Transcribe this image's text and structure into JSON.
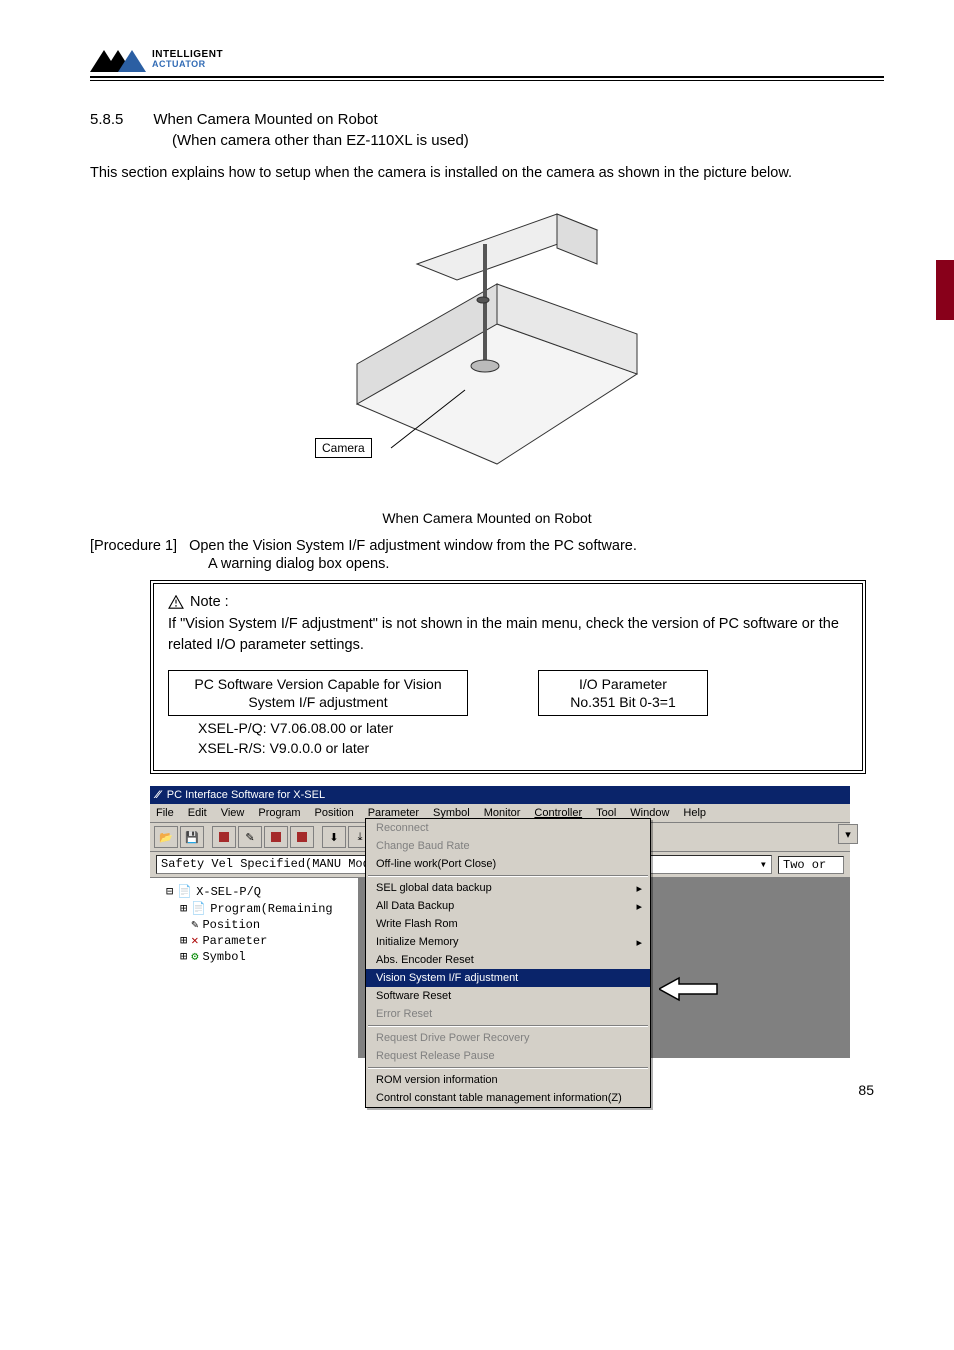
{
  "logo": {
    "line1": "INTELLIGENT",
    "line2": "ACTUATOR"
  },
  "section": {
    "number": "5.8.5",
    "title1": "When Camera Mounted on Robot",
    "title2": "(When camera other than EZ-110XL is used)"
  },
  "intro": "This section explains how to setup when the camera is installed on the camera as shown in the picture below.",
  "figure": {
    "camera_label": "Camera",
    "caption": "When Camera Mounted on Robot"
  },
  "procedure": {
    "label": "[Procedure 1]",
    "line1": "Open the Vision System I/F adjustment window from the PC software.",
    "line2": "A warning dialog box opens."
  },
  "note": {
    "head": "Note :",
    "body": "If \"Vision System I/F adjustment\" is not shown in the main menu, check the version of PC software or the related I/O parameter settings.",
    "left_box_l1": "PC Software Version Capable for Vision",
    "left_box_l2": "System I/F adjustment",
    "left_sub1": "XSEL-P/Q: V7.06.08.00 or later",
    "left_sub2": "XSEL-R/S: V9.0.0.0 or later",
    "right_box_l1": "I/O Parameter",
    "right_box_l2": "No.351 Bit 0-3=1"
  },
  "screenshot": {
    "title": "PC Interface Software for X-SEL",
    "menu": [
      "File",
      "Edit",
      "View",
      "Program",
      "Position",
      "Parameter",
      "Symbol",
      "Monitor",
      "Controller",
      "Tool",
      "Window",
      "Help"
    ],
    "safety_label": "Safety Vel Specified(MANU Mode)",
    "two_or": "Two or",
    "tree": {
      "root": "X-SEL-P/Q",
      "items": [
        "Program(Remaining",
        "Position",
        "Parameter",
        "Symbol"
      ]
    },
    "ctx": [
      {
        "t": "Reconnect",
        "d": true
      },
      {
        "t": "Change Baud Rate",
        "d": true
      },
      {
        "t": "Off-line work(Port Close)",
        "d": false
      },
      {
        "sep": true
      },
      {
        "t": "SEL global data backup",
        "d": false,
        "a": true
      },
      {
        "t": "All Data Backup",
        "d": false,
        "a": true
      },
      {
        "t": "Write Flash Rom",
        "d": false
      },
      {
        "t": "Initialize Memory",
        "d": false,
        "a": true
      },
      {
        "t": "Abs. Encoder Reset",
        "d": false
      },
      {
        "t": "Vision System I/F adjustment",
        "d": false,
        "hl": true
      },
      {
        "t": "Software Reset",
        "d": false
      },
      {
        "t": "Error Reset",
        "d": true
      },
      {
        "sep": true
      },
      {
        "t": "Request Drive Power Recovery",
        "d": true
      },
      {
        "t": "Request Release Pause",
        "d": true
      },
      {
        "sep": true
      },
      {
        "t": "ROM version information",
        "d": false
      },
      {
        "t": "Control constant table management information(Z)",
        "d": false
      }
    ]
  },
  "pagenum": "85"
}
